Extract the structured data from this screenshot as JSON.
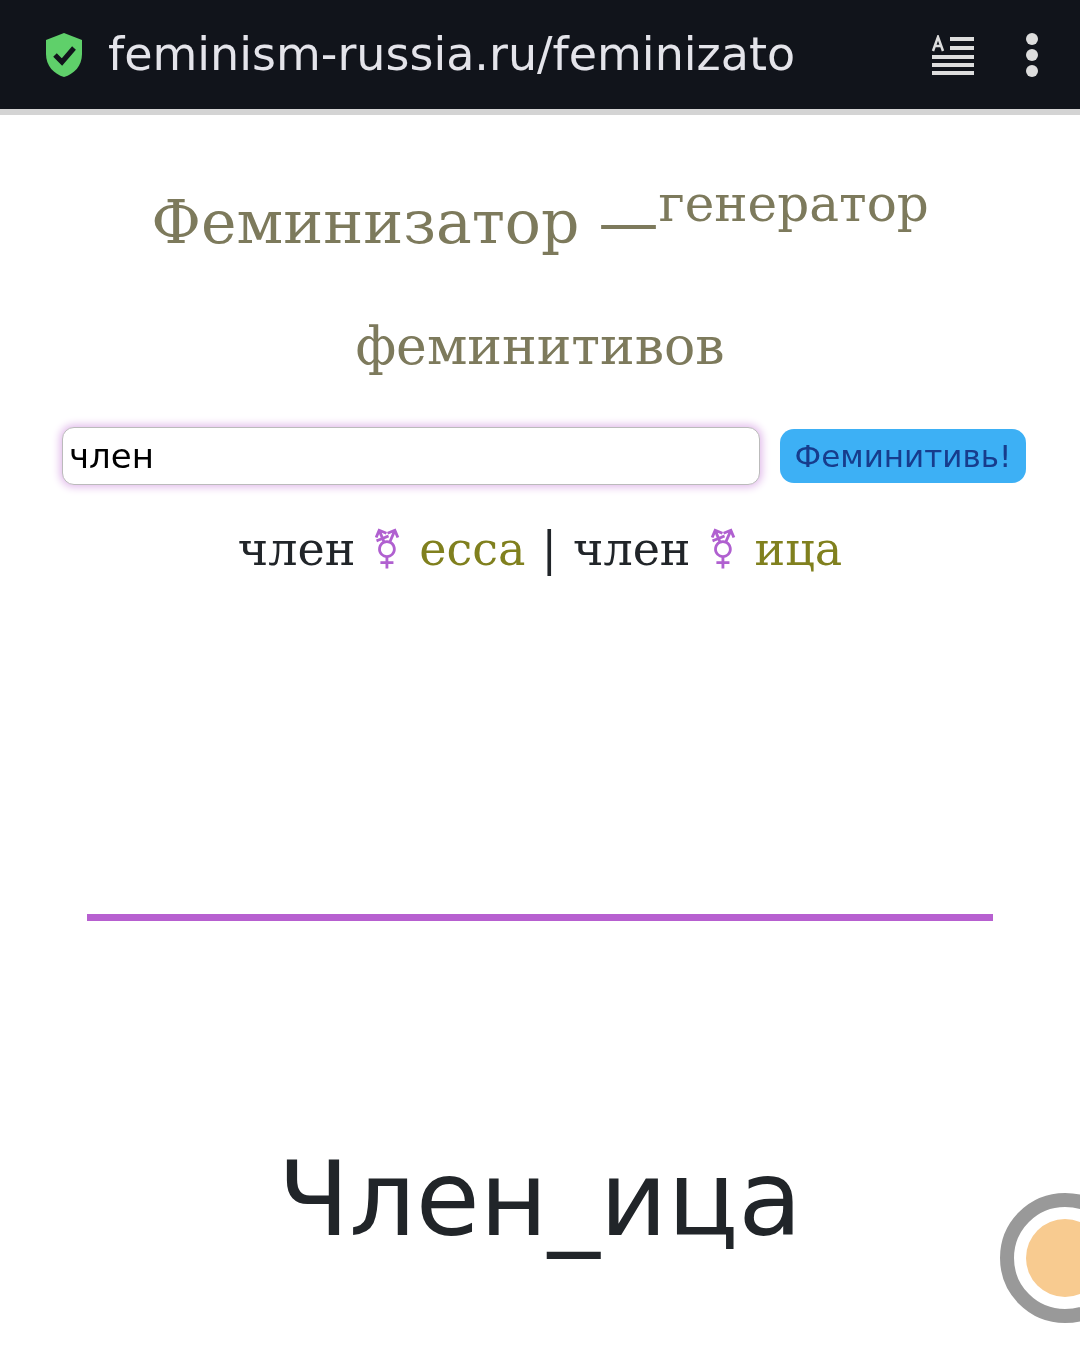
{
  "address_bar": {
    "url": "feminism-russia.ru/feminizato"
  },
  "title": {
    "text": "Феминизатор —",
    "tagline": [
      "генератор",
      "феминитивов"
    ]
  },
  "search": {
    "value": "член",
    "button": "Феминитивь!"
  },
  "results": [
    {
      "base": "член",
      "symbol": "⚧",
      "suffix": "есса"
    },
    {
      "base": "член",
      "symbol": "⚧",
      "suffix": "ица"
    }
  ],
  "separator": "|",
  "article_heading": "Член_ица"
}
